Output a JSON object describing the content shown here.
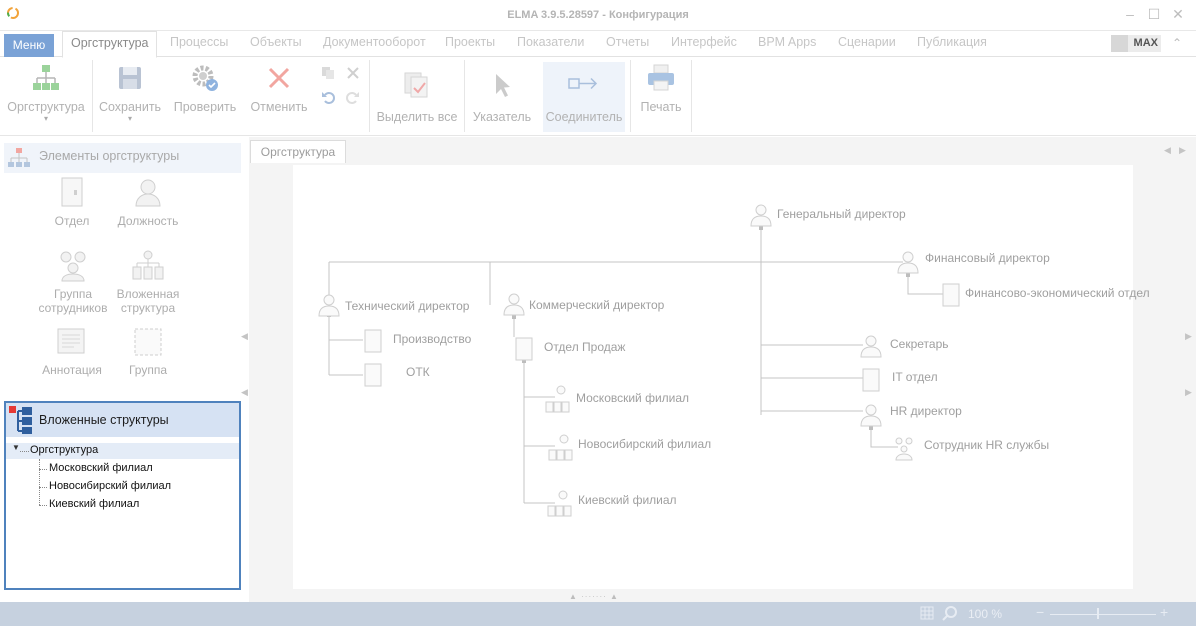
{
  "window": {
    "title": "ELMA 3.9.5.28597 - Конфигурация"
  },
  "menu": {
    "menu_label": "Меню",
    "tabs": [
      {
        "label": "Оргструктура",
        "active": true
      },
      {
        "label": "Процессы"
      },
      {
        "label": "Объекты"
      },
      {
        "label": "Документооборот"
      },
      {
        "label": "Проекты"
      },
      {
        "label": "Показатели"
      },
      {
        "label": "Отчеты"
      },
      {
        "label": "Интерфейс"
      },
      {
        "label": "BPM Apps"
      },
      {
        "label": "Сценарии"
      },
      {
        "label": "Публикация"
      }
    ],
    "max_badge": "MAX"
  },
  "ribbon": {
    "orgstructure": "Оргструктура",
    "save": "Сохранить",
    "check": "Проверить",
    "cancel": "Отменить",
    "select_all": "Выделить все",
    "pointer": "Указатель",
    "connector": "Соединитель",
    "print": "Печать"
  },
  "elements_panel": {
    "title": "Элементы оргструктуры",
    "items": [
      {
        "label": "Отдел",
        "icon": "department-icon"
      },
      {
        "label": "Должность",
        "icon": "position-icon"
      },
      {
        "label": "Группа сотрудников",
        "line1": "Группа",
        "line2": "сотрудников",
        "icon": "employee-group-icon"
      },
      {
        "label": "Вложенная структура",
        "line1": "Вложенная",
        "line2": "структура",
        "icon": "nested-structure-icon"
      },
      {
        "label": "Аннотация",
        "icon": "annotation-icon"
      },
      {
        "label": "Группа",
        "icon": "group-frame-icon"
      }
    ]
  },
  "nested_panel": {
    "title": "Вложенные структуры",
    "root": "Оргструктура",
    "children": [
      "Московский филиал",
      "Новосибирский филиал",
      "Киевский филиал"
    ]
  },
  "document": {
    "tab": "Оргструктура",
    "nodes": {
      "ceo": "Генеральный директор",
      "cfo": "Финансовый директор",
      "fin_econ_dept": "Финансово-экономический отдел",
      "tech_director": "Технический директор",
      "production": "Производство",
      "qc": "ОТК",
      "commercial_director": "Коммерческий директор",
      "sales_dept": "Отдел Продаж",
      "moscow": "Московский филиал",
      "novosibirsk": "Новосибирский филиал",
      "kiev": "Киевский филиал",
      "secretary": "Секретарь",
      "it_dept": "IT отдел",
      "hr_director": "HR директор",
      "hr_staff": "Сотрудник HR службы"
    }
  },
  "status": {
    "zoom": "100 %"
  },
  "colors": {
    "accent": "#4f82bd",
    "menu_button": "#7aa2d6",
    "statusbar": "#c6d1df",
    "selection": "#d6e2f3"
  }
}
